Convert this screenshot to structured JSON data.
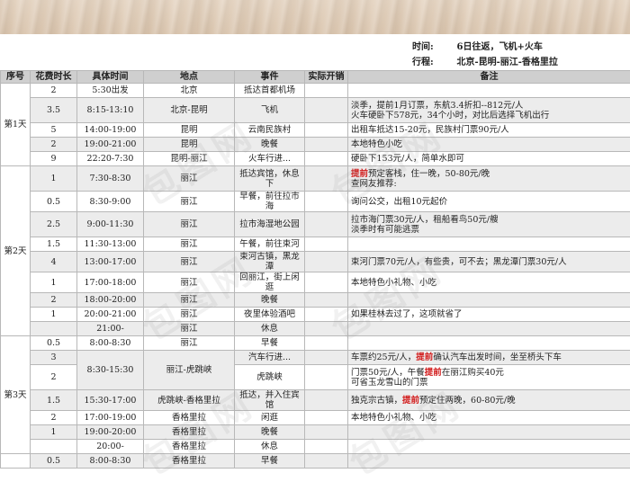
{
  "header": {
    "time_label": "时间:",
    "time_value": "6日往返，飞机+火车",
    "route_label": "行程:",
    "route_value": "北京-昆明-丽江-香格里拉"
  },
  "columns": [
    "序号",
    "花费时长",
    "具体时间",
    "地点",
    "事件",
    "实际开销",
    "备注"
  ],
  "days": [
    {
      "label": "第1天",
      "rows": [
        {
          "dur": "2",
          "time": "5:30出发",
          "place": "北京",
          "event": "抵达首都机场",
          "note": [
            [
              [
                "",
                ""
              ]
            ]
          ]
        },
        {
          "dur": "3.5",
          "time": "8:15-13:10",
          "place": "北京-昆明",
          "event": "飞机",
          "note": [
            [
              [
                "淡季，提前1月订票，东航3.4折扣--812元/人",
                ""
              ]
            ],
            [
              [
                "火车硬卧下578元，34个小时，对比后选择飞机出行",
                ""
              ]
            ]
          ]
        },
        {
          "dur": "5",
          "time": "14:00-19:00",
          "place": "昆明",
          "event": "云南民族村",
          "note": [
            [
              [
                "出租车抵达15-20元，民族村门票90元/人",
                ""
              ]
            ]
          ]
        },
        {
          "dur": "2",
          "time": "19:00-21:00",
          "place": "昆明",
          "event": "晚餐",
          "note": [
            [
              [
                "本地特色小吃",
                ""
              ]
            ]
          ]
        },
        {
          "dur": "9",
          "time": "22:20-7:30",
          "place": "昆明-丽江",
          "event": "火车行进...",
          "note": [
            [
              [
                "硬卧下153元/人，简单水即可",
                ""
              ]
            ]
          ]
        }
      ]
    },
    {
      "label": "第2天",
      "rows": [
        {
          "dur": "1",
          "time": "7:30-8:30",
          "place": "丽江",
          "event": "抵达宾馆，休息下",
          "note": [
            [
              [
                "提前",
                "hl"
              ],
              [
                "预定客栈，住一晚，50-80元/晚",
                ""
              ]
            ],
            [
              [
                "查网友推荐:",
                ""
              ]
            ]
          ]
        },
        {
          "dur": "0.5",
          "time": "8:30-9:00",
          "place": "丽江",
          "event": "早餐，前往拉市海",
          "note": [
            [
              [
                "询问公交，出租10元起价",
                ""
              ]
            ]
          ]
        },
        {
          "dur": "2.5",
          "time": "9:00-11:30",
          "place": "丽江",
          "event": "拉市海湿地公园",
          "note": [
            [
              [
                "拉市海门票30元/人，租船看鸟50元/艘",
                ""
              ]
            ],
            [
              [
                "淡季时有可能逃票",
                ""
              ]
            ]
          ]
        },
        {
          "dur": "1.5",
          "time": "11:30-13:00",
          "place": "丽江",
          "event": "午餐，前往束河",
          "note": [
            [
              [
                "",
                ""
              ]
            ]
          ]
        },
        {
          "dur": "4",
          "time": "13:00-17:00",
          "place": "丽江",
          "event": "束河古镇，黑龙潭",
          "note": [
            [
              [
                "束河门票70元/人，有些贵，可不去；黑龙潭门票30元/人",
                ""
              ]
            ]
          ]
        },
        {
          "dur": "1",
          "time": "17:00-18:00",
          "place": "丽江",
          "event": "回丽江，街上闲逛",
          "note": [
            [
              [
                "本地特色小礼物、小吃",
                ""
              ]
            ]
          ]
        },
        {
          "dur": "2",
          "time": "18:00-20:00",
          "place": "丽江",
          "event": "晚餐",
          "note": [
            [
              [
                "",
                ""
              ]
            ]
          ]
        },
        {
          "dur": "1",
          "time": "20:00-21:00",
          "place": "丽江",
          "event": "夜里体验酒吧",
          "note": [
            [
              [
                "如果桂林去过了，这项就省了",
                ""
              ]
            ]
          ]
        },
        {
          "dur": "",
          "time": "21:00-",
          "place": "丽江",
          "event": "休息",
          "note": [
            [
              [
                "",
                ""
              ]
            ]
          ]
        }
      ]
    },
    {
      "label": "第3天",
      "rows": [
        {
          "dur": "0.5",
          "time": "8:00-8:30",
          "place": "丽江",
          "event": "早餐",
          "note": [
            [
              [
                "",
                ""
              ]
            ]
          ]
        },
        {
          "dur": "3",
          "time": "8:30-15:30",
          "place": "丽江-虎跳峡",
          "event": "汽车行进...",
          "note": [
            [
              [
                "车票约25元/人，",
                ""
              ],
              [
                "提前",
                "hl"
              ],
              [
                "确认汽车出发时间，坐至桥头下车",
                ""
              ]
            ]
          ],
          "merge_time": true
        },
        {
          "dur": "2",
          "time": "",
          "place": "",
          "event": "虎跳峡",
          "note": [
            [
              [
                "门票50元/人，午餐",
                ""
              ],
              [
                "提前",
                "hl"
              ],
              [
                "在丽江购买40元",
                ""
              ]
            ],
            [
              [
                "可省玉龙雪山的门票",
                ""
              ]
            ]
          ],
          "merged": true
        },
        {
          "dur": "1.5",
          "time": "15:30-17:00",
          "place": "虎跳峡-香格里拉",
          "event": "抵达，并入住宾馆",
          "note": [
            [
              [
                "独克宗古镇，",
                ""
              ],
              [
                "提前",
                "hl"
              ],
              [
                "预定住两晚，60-80元/晚",
                ""
              ]
            ]
          ]
        },
        {
          "dur": "2",
          "time": "17:00-19:00",
          "place": "香格里拉",
          "event": "闲逛",
          "note": [
            [
              [
                "本地特色小礼物、小吃",
                ""
              ]
            ]
          ]
        },
        {
          "dur": "1",
          "time": "19:00-20:00",
          "place": "香格里拉",
          "event": "晚餐",
          "note": [
            [
              [
                "",
                ""
              ]
            ]
          ]
        },
        {
          "dur": "",
          "time": "20:00-",
          "place": "香格里拉",
          "event": "休息",
          "note": [
            [
              [
                "",
                ""
              ]
            ]
          ]
        }
      ]
    },
    {
      "label": "",
      "rows": [
        {
          "dur": "0.5",
          "time": "8:00-8:30",
          "place": "香格里拉",
          "event": "早餐",
          "note": [
            [
              [
                "",
                ""
              ]
            ]
          ]
        }
      ]
    }
  ],
  "watermark": "包图网"
}
